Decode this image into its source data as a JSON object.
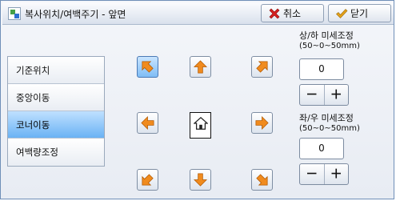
{
  "title": "복사위치/여백주기 - 앞면",
  "toolbar": {
    "cancel_label": "취소",
    "close_label": "닫기"
  },
  "menu": {
    "items": [
      {
        "label": "기준위치",
        "selected": false
      },
      {
        "label": "중앙이동",
        "selected": false
      },
      {
        "label": "코너이동",
        "selected": true
      },
      {
        "label": "여백량조정",
        "selected": false
      }
    ]
  },
  "arrows": {
    "selected": "up-left",
    "colors": {
      "arrow": "#f08b1e",
      "outline": "#b45a00",
      "home": "#222222"
    }
  },
  "vertical_adjust": {
    "label": "상/하 미세조정",
    "range": "(50~0~50mm)",
    "value": "0"
  },
  "horizontal_adjust": {
    "label": "좌/우 미세조정",
    "range": "(50~0~50mm)",
    "value": "0"
  },
  "stepper": {
    "minus": "－",
    "plus": "＋"
  }
}
